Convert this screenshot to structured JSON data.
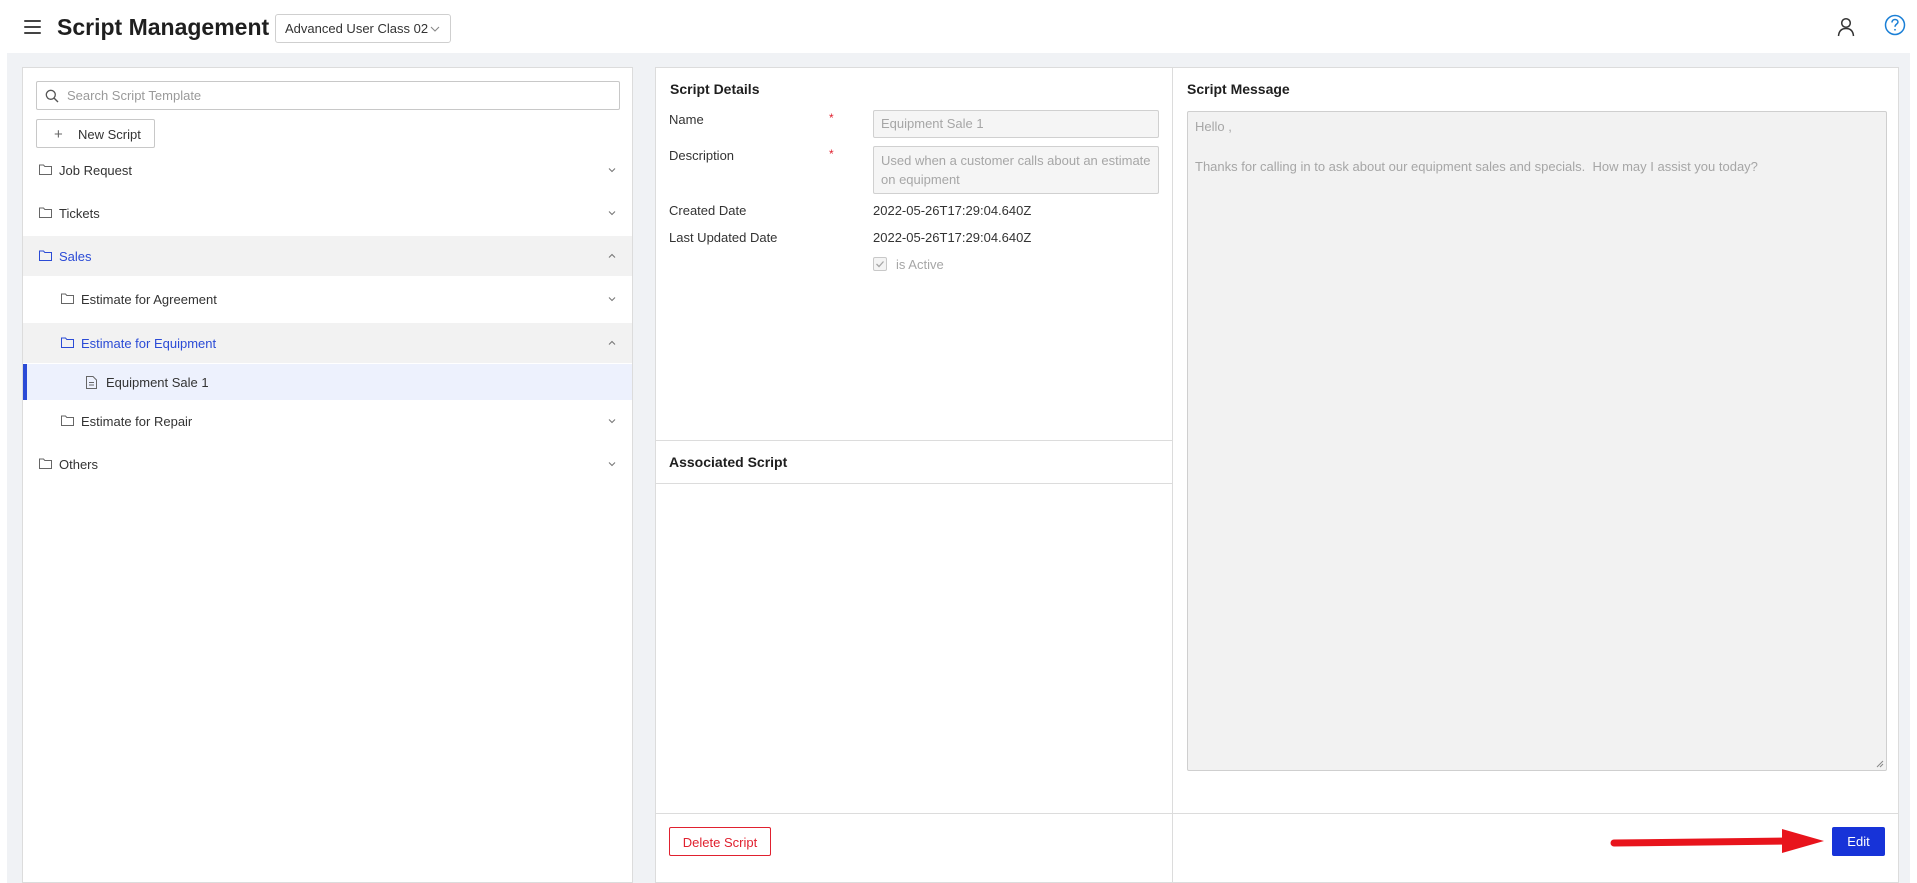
{
  "header": {
    "title": "Script Management",
    "org_select": "Advanced User Class 02"
  },
  "search": {
    "placeholder": "Search Script Template"
  },
  "new_script_label": "New Script",
  "tree": [
    {
      "label": "Job Request",
      "expanded": false
    },
    {
      "label": "Tickets",
      "expanded": false
    },
    {
      "label": "Sales",
      "expanded": true
    },
    {
      "label": "Estimate for Agreement",
      "expanded": false
    },
    {
      "label": "Estimate for Equipment",
      "expanded": true
    },
    {
      "label": "Equipment Sale 1",
      "selected": true
    },
    {
      "label": "Estimate for Repair",
      "expanded": false
    },
    {
      "label": "Others",
      "expanded": false
    }
  ],
  "details": {
    "title": "Script Details",
    "name_label": "Name",
    "name_value": "Equipment Sale 1",
    "description_label": "Description",
    "description_value": "Used when a customer calls about an estimate on equipment",
    "created_label": "Created Date",
    "created_value": "2022-05-26T17:29:04.640Z",
    "updated_label": "Last Updated Date",
    "updated_value": "2022-05-26T17:29:04.640Z",
    "active_label": "is Active",
    "required_mark": "*"
  },
  "associated": {
    "title": "Associated Script"
  },
  "message": {
    "title": "Script Message",
    "line1": "Hello ,",
    "line2": "Thanks for calling in to ask about our equipment sales and specials.  How may I assist you today?"
  },
  "actions": {
    "delete_label": "Delete Script",
    "edit_label": "Edit"
  },
  "colors": {
    "accent": "#2b4bd6",
    "edit_button": "#1733d8",
    "danger": "#e0212f",
    "annotation_arrow": "#e8141c"
  }
}
